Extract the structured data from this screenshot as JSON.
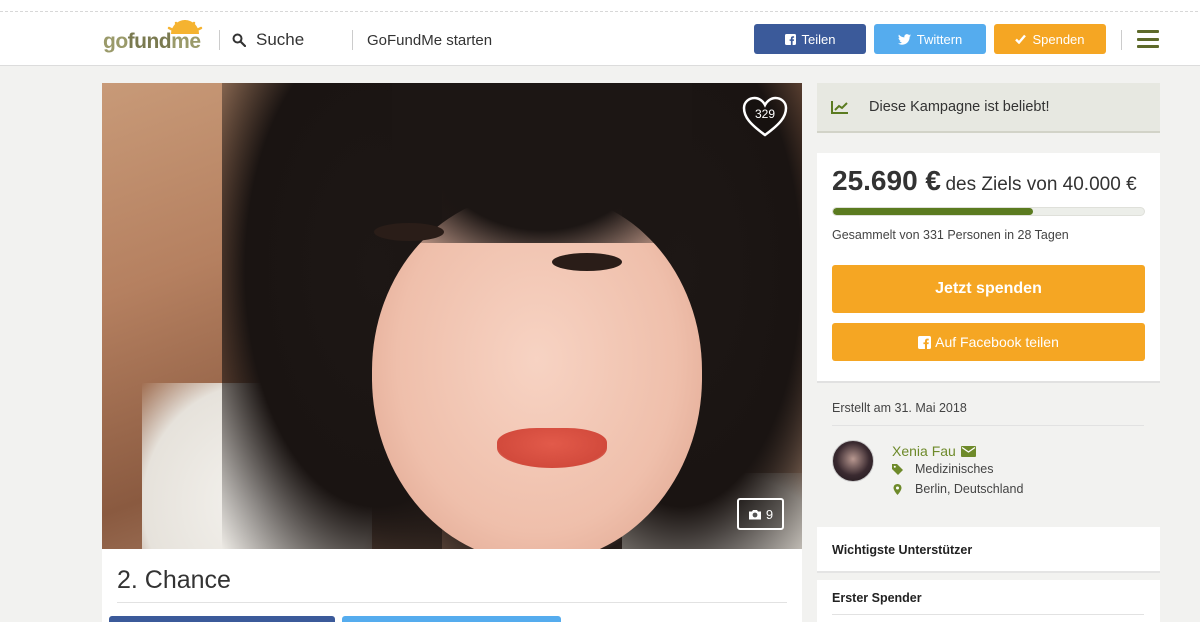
{
  "header": {
    "logo": "gofundme",
    "search_label": "Suche",
    "start_link": "GoFundMe starten",
    "share_button": "Teilen",
    "tweet_button": "Twittern",
    "donate_button": "Spenden"
  },
  "campaign": {
    "title": "2. Chance",
    "likes": "329",
    "photo_count": "9",
    "popular_banner": "Diese Kampagne ist beliebt!",
    "raised": "25.690 €",
    "goal_text": "des Ziels von 40.000 €",
    "progress_fraction": 0.6423,
    "collected_text": "Gesammelt von 331 Personen in 28 Tagen",
    "donate_now": "Jetzt spenden",
    "facebook_share": "Auf Facebook teilen",
    "created": "Erstellt am 31. Mai 2018",
    "organizer": "Xenia Fau",
    "category": "Medizinisches",
    "location": "Berlin, Deutschland",
    "top_supporters": "Wichtigste Unterstützer",
    "first_donor": "Erster Spender"
  },
  "colors": {
    "facebook": "#3b5a9a",
    "twitter": "#55acee",
    "donate": "#f5a623",
    "progress": "#5b7b20",
    "brand_green": "#6e8a2a"
  }
}
